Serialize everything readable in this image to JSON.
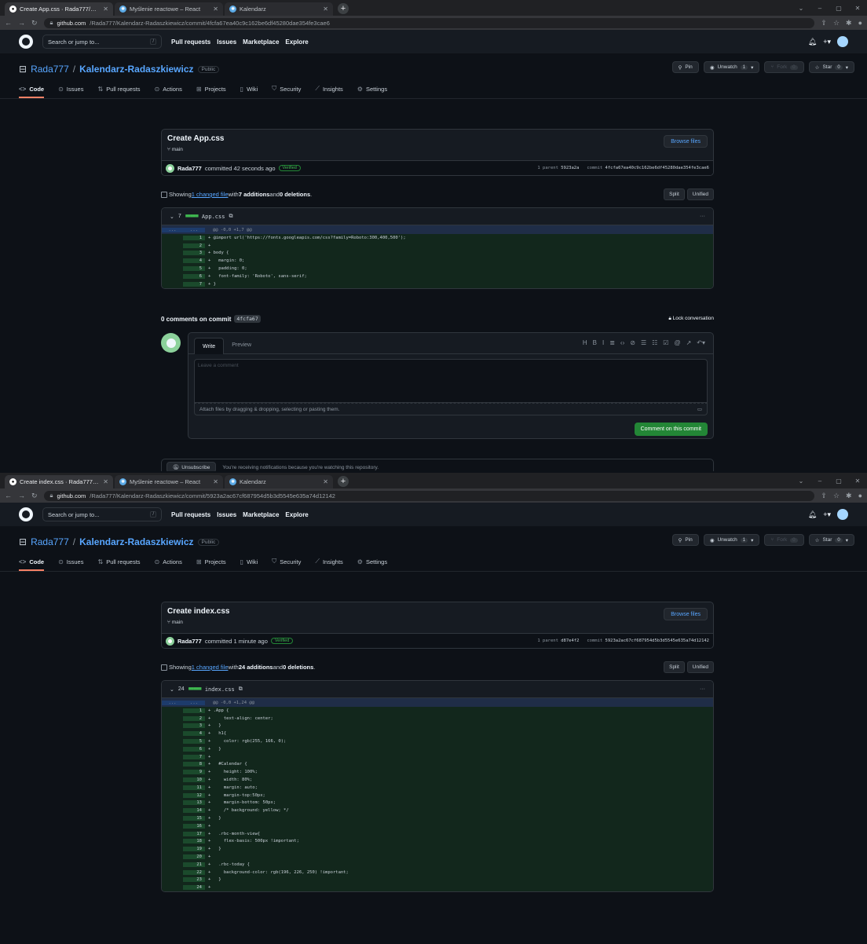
{
  "shot1": {
    "tabs": [
      {
        "title": "Create App.css · Rada777/Kalend",
        "favicon": "github-icon"
      },
      {
        "title": "Myślenie reactowe – React",
        "favicon": "react-icon"
      },
      {
        "title": "Kalendarz",
        "favicon": "react-icon"
      }
    ],
    "url_host": "github.com",
    "url_path": "/Rada777/Kalendarz-Radaszkiewicz/commit/4fcfa67ea40c9c162be6df45280dae354fe3cae6",
    "commit_title": "Create App.css",
    "branch": "main",
    "author": "Rada777",
    "committed_text": "committed 42 seconds ago",
    "parent_label": "1 parent",
    "parent_sha": "5923a2a",
    "commit_label": "commit",
    "commit_sha": "4fcfa67ea40c9c162be6df45280dae354fe3cae6",
    "stats": {
      "showing": "Showing ",
      "link": "1 changed file",
      "mid": " with ",
      "additions": "7 additions",
      "and": " and ",
      "deletions": "0 deletions",
      "end": "."
    },
    "file": {
      "count": "7",
      "name": "App.css"
    },
    "hunk": "@@ -0,0 +1,7 @@",
    "lines": [
      {
        "n": "1",
        "code": "+ @import url('https://fonts.googleapis.com/css?family=Roboto:300,400,500');"
      },
      {
        "n": "2",
        "code": "+"
      },
      {
        "n": "3",
        "code": "+ body {"
      },
      {
        "n": "4",
        "code": "+   margin: 0;"
      },
      {
        "n": "5",
        "code": "+   padding: 0;"
      },
      {
        "n": "6",
        "code": "+   font-family: 'Roboto', sans-serif;"
      },
      {
        "n": "7",
        "code": "+ }"
      }
    ],
    "comments_heading": "0 comments on commit",
    "comments_sha": "4fcfa67",
    "lock_label": "Lock conversation",
    "write_tab": "Write",
    "preview_tab": "Preview",
    "comment_placeholder": "Leave a comment",
    "attach_hint": "Attach files by dragging & dropping, selecting or pasting them.",
    "comment_button": "Comment on this commit",
    "unsubscribe": "Unsubscribe",
    "notify_text": "You're receiving notifications because you're watching this repository."
  },
  "shot2": {
    "tabs": [
      {
        "title": "Create index.css · Rada777/Kalen",
        "favicon": "github-icon"
      },
      {
        "title": "Myślenie reactowe – React",
        "favicon": "react-icon"
      },
      {
        "title": "Kalendarz",
        "favicon": "react-icon"
      }
    ],
    "url_host": "github.com",
    "url_path": "/Rada777/Kalendarz-Radaszkiewicz/commit/5923a2ac67cf687954d5b3d5545e635a74d12142",
    "commit_title": "Create index.css",
    "branch": "main",
    "author": "Rada777",
    "committed_text": "committed 1 minute ago",
    "parent_label": "1 parent",
    "parent_sha": "d87e4f2",
    "commit_label": "commit",
    "commit_sha": "5923a2ac67cf687954d5b3d5545e635a74d12142",
    "stats": {
      "showing": "Showing ",
      "link": "1 changed file",
      "mid": " with ",
      "additions": "24 additions",
      "and": " and ",
      "deletions": "0 deletions",
      "end": "."
    },
    "file": {
      "count": "24",
      "name": "index.css"
    },
    "hunk": "@@ -0,0 +1,24 @@",
    "lines": [
      {
        "n": "1",
        "code": "+ .App {"
      },
      {
        "n": "2",
        "code": "+     text-align: center;"
      },
      {
        "n": "3",
        "code": "+   }"
      },
      {
        "n": "4",
        "code": "+   h1{"
      },
      {
        "n": "5",
        "code": "+     color: rgb(255, 166, 0);"
      },
      {
        "n": "6",
        "code": "+   }"
      },
      {
        "n": "7",
        "code": "+"
      },
      {
        "n": "8",
        "code": "+   #Calendar {"
      },
      {
        "n": "9",
        "code": "+     height: 100%;"
      },
      {
        "n": "10",
        "code": "+     width: 80%;"
      },
      {
        "n": "11",
        "code": "+     margin: auto;"
      },
      {
        "n": "12",
        "code": "+     margin-top:50px;"
      },
      {
        "n": "13",
        "code": "+     margin-bottom: 50px;"
      },
      {
        "n": "14",
        "code": "+     /* background: yellow; */"
      },
      {
        "n": "15",
        "code": "+   }"
      },
      {
        "n": "16",
        "code": "+"
      },
      {
        "n": "17",
        "code": "+   .rbc-month-view{"
      },
      {
        "n": "18",
        "code": "+     flex-basis: 500px !important;"
      },
      {
        "n": "19",
        "code": "+   }"
      },
      {
        "n": "20",
        "code": "+"
      },
      {
        "n": "21",
        "code": "+   .rbc-today {"
      },
      {
        "n": "22",
        "code": "+     background-color: rgb(196, 226, 250) !important;"
      },
      {
        "n": "23",
        "code": "+   }"
      },
      {
        "n": "24",
        "code": "+"
      }
    ]
  },
  "common": {
    "search_placeholder": "Search or jump to...",
    "search_kbd": "/",
    "nav": [
      "Pull requests",
      "Issues",
      "Marketplace",
      "Explore"
    ],
    "owner": "Rada777",
    "repo": "Kalendarz-Radaszkiewicz",
    "visibility": "Public",
    "pin": "Pin",
    "unwatch": "Unwatch",
    "watch_count": "1",
    "fork": "Fork",
    "fork_count": "0",
    "star": "Star",
    "star_count": "0",
    "repo_tabs": [
      "Code",
      "Issues",
      "Pull requests",
      "Actions",
      "Projects",
      "Wiki",
      "Security",
      "Insights",
      "Settings"
    ],
    "browse_files": "Browse files",
    "verified": "Verified",
    "split": "Split",
    "unified": "Unified",
    "hunk_dots": "...",
    "file_menu": "···"
  },
  "colors": {
    "accent": "#58a6ff",
    "added": "#3fb950",
    "button_green": "#238636",
    "tab_underline": "#f78166"
  }
}
